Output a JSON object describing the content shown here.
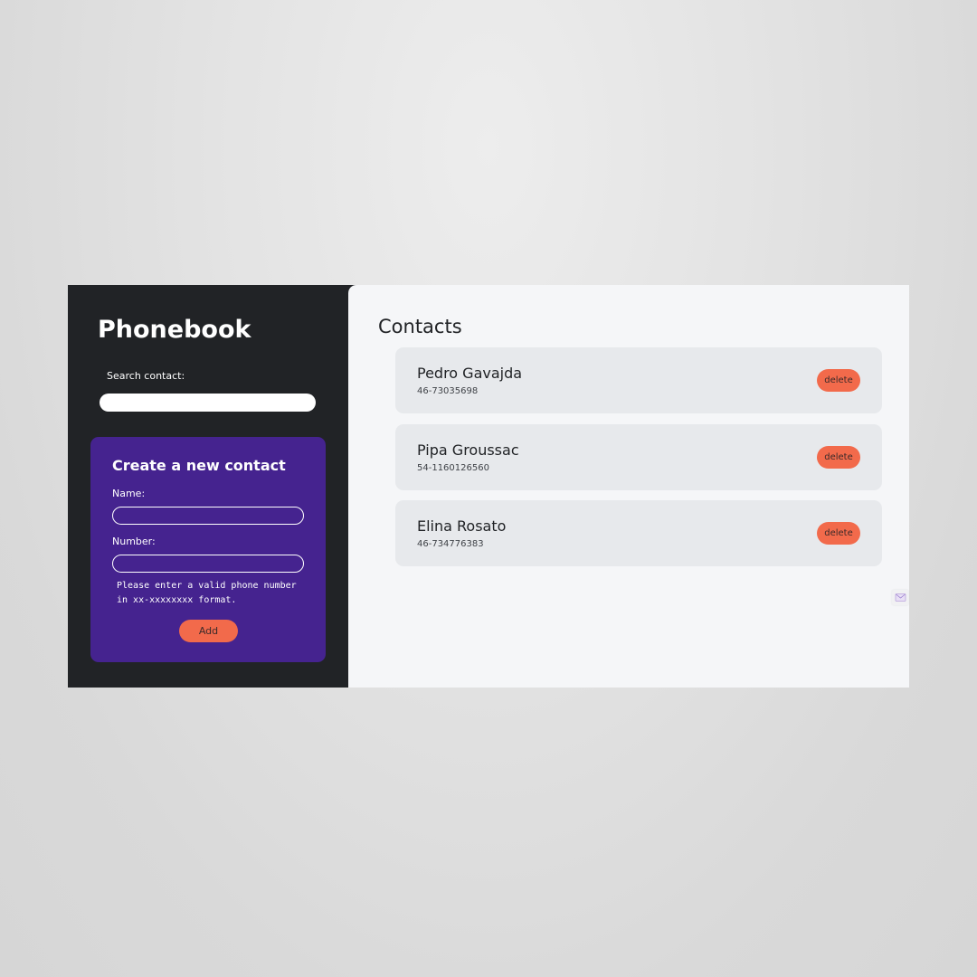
{
  "sidebar": {
    "title": "Phonebook",
    "search": {
      "label": "Search contact:",
      "value": "",
      "placeholder": ""
    },
    "create": {
      "title": "Create a new contact",
      "name_label": "Name:",
      "name_value": "",
      "number_label": "Number:",
      "number_value": "",
      "hint": "Please enter a valid phone number in xx-xxxxxxxx format.",
      "add_label": "Add"
    }
  },
  "main": {
    "title": "Contacts",
    "contacts": [
      {
        "name": "Pedro Gavajda",
        "number": "46-73035698",
        "delete_label": "delete"
      },
      {
        "name": "Pipa Groussac",
        "number": "54-1160126560",
        "delete_label": "delete"
      },
      {
        "name": "Elina Rosato",
        "number": "46-734776383",
        "delete_label": "delete"
      }
    ]
  },
  "colors": {
    "sidebar_bg": "#212326",
    "card_purple": "#45238f",
    "accent_orange": "#f26a4b",
    "main_bg": "#f5f6f8",
    "contact_card_bg": "#e7e9ec"
  },
  "icons": {
    "edge_widget": "mail-icon"
  }
}
